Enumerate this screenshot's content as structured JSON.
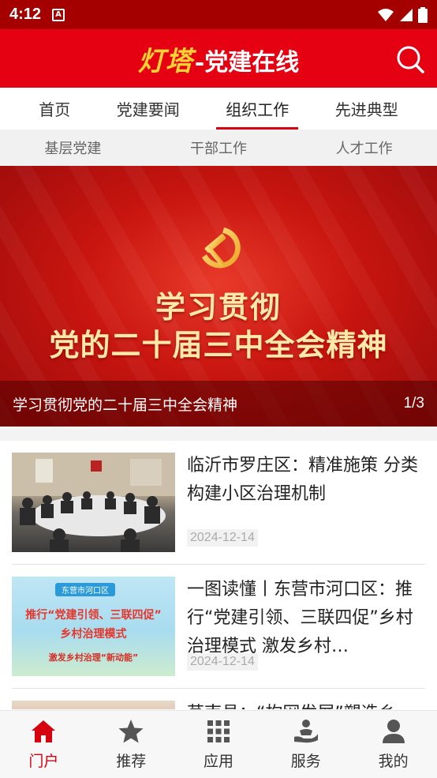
{
  "status_bar": {
    "time": "4:12",
    "notif_letter": "A"
  },
  "header": {
    "brand": "灯塔",
    "title": "-党建在线"
  },
  "tabs": [
    {
      "label": "首页",
      "active": false
    },
    {
      "label": "党建要闻",
      "active": false
    },
    {
      "label": "组织工作",
      "active": true
    },
    {
      "label": "先进典型",
      "active": false
    }
  ],
  "subtabs": [
    {
      "label": "基层党建"
    },
    {
      "label": "干部工作"
    },
    {
      "label": "人才工作"
    }
  ],
  "banner": {
    "headline_line1": "学习贯彻",
    "headline_line2": "党的二十届三中全会精神",
    "caption": "学习贯彻党的二十届三中全会精神",
    "counter": "1/3"
  },
  "news": [
    {
      "title": "临沂市罗庄区：精准施策 分类构建小区治理机制",
      "date": "2024-12-14"
    },
    {
      "title": "一图读懂丨东营市河口区：推行“党建引领、三联四促”乡村治理模式 激发乡村…",
      "date": "2024-12-14",
      "thumb_text": {
        "tag": "东营市河口区",
        "line1": "推行“党建引领、三联四促”",
        "line2": "乡村治理模式",
        "line3": "激发乡村治理“新动能”"
      }
    },
    {
      "title": "莒南县：“构网发展”塑造乡",
      "date": ""
    }
  ],
  "bottom_nav": [
    {
      "label": "门户",
      "icon": "home-icon",
      "active": true
    },
    {
      "label": "推荐",
      "icon": "star-icon",
      "active": false
    },
    {
      "label": "应用",
      "icon": "grid-icon",
      "active": false
    },
    {
      "label": "服务",
      "icon": "service-icon",
      "active": false
    },
    {
      "label": "我的",
      "icon": "profile-icon",
      "active": false
    }
  ],
  "colors": {
    "header_red": "#e50012",
    "status_red": "#a50000",
    "active_red": "#d7000f",
    "brand_gold": "#ffd233"
  }
}
